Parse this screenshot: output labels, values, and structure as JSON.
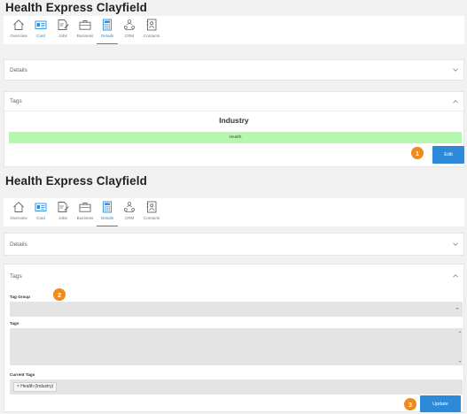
{
  "top": {
    "title": "Health Express Clayfield",
    "tabs": [
      {
        "label": "Overview",
        "icon": "home-icon",
        "active": false
      },
      {
        "label": "Card",
        "icon": "id-card-icon",
        "active": false
      },
      {
        "label": "Jobs",
        "icon": "edit-document-icon",
        "active": false
      },
      {
        "label": "Business",
        "icon": "briefcase-icon",
        "active": false
      },
      {
        "label": "Details",
        "icon": "calculator-icon",
        "active": true
      },
      {
        "label": "CRM",
        "icon": "people-network-icon",
        "active": false
      },
      {
        "label": "Contacts",
        "icon": "contact-book-icon",
        "active": false
      }
    ],
    "details_header": "Details",
    "tags_header": "Tags",
    "group_title": "Industry",
    "tag_value": "Health",
    "edit_button": "Edit",
    "badge": "1"
  },
  "bottom": {
    "title": "Health Express Clayfield",
    "tabs": [
      {
        "label": "Overview",
        "icon": "home-icon",
        "active": false
      },
      {
        "label": "Card",
        "icon": "id-card-icon",
        "active": false
      },
      {
        "label": "Jobs",
        "icon": "edit-document-icon",
        "active": false
      },
      {
        "label": "Business",
        "icon": "briefcase-icon",
        "active": false
      },
      {
        "label": "Details",
        "icon": "calculator-icon",
        "active": true
      },
      {
        "label": "CRM",
        "icon": "people-network-icon",
        "active": false
      },
      {
        "label": "Contacts",
        "icon": "contact-book-icon",
        "active": false
      }
    ],
    "details_header": "Details",
    "tags_header": "Tags",
    "tag_group_label": "Tag Group",
    "tag_group_value": "",
    "tags_label": "Tags",
    "tags_value": "",
    "current_tags_label": "Current Tags",
    "current_tags": [
      "× Health (Industry)"
    ],
    "update_button": "Update",
    "badge_2": "2",
    "badge_3": "3"
  },
  "colors": {
    "accent": "#2d8ad8",
    "badge": "#f08a1c",
    "tag_bar": "#b6f7ae"
  }
}
